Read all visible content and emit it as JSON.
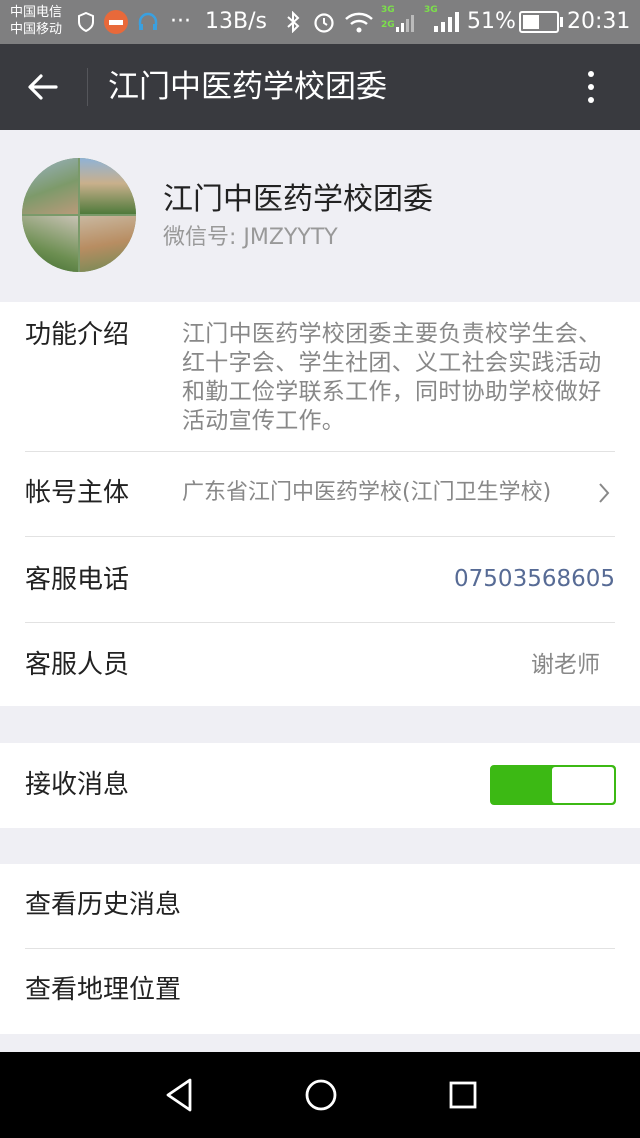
{
  "status_bar": {
    "carrier_1": "中国电信",
    "carrier_2": "中国移动",
    "more": "···",
    "speed": "13B/s",
    "net_tag_1": "3G",
    "net_tag_2": "2G",
    "net_tag_3": "3G",
    "battery_percent": "51%",
    "battery_level": 0.51,
    "time": "20:31",
    "icons": [
      "shield-icon",
      "app-icon",
      "headset-icon",
      "bluetooth-icon",
      "alarm-icon",
      "wifi-icon",
      "signal-icon",
      "battery-icon"
    ]
  },
  "header": {
    "title": "江门中医药学校团委"
  },
  "profile": {
    "name": "江门中医药学校团委",
    "wechat_id": "微信号: JMZYYTY"
  },
  "info": {
    "intro_label": "功能介绍",
    "intro_text": "江门中医药学校团委主要负责校学生会、红十字会、学生社团、义工社会实践活动和勤工俭学联系工作，同时协助学校做好活动宣传工作。",
    "entity_label": "帐号主体",
    "entity_value": "广东省江门中医药学校(江门卫生学校)",
    "phone_label": "客服电话",
    "phone_value": "07503568605",
    "staff_label": "客服人员",
    "staff_value": "谢老师"
  },
  "messages": {
    "receive_label": "接收消息",
    "receive_on": true
  },
  "actions": {
    "history_label": "查看历史消息",
    "location_label": "查看地理位置"
  },
  "colors": {
    "title_bar": "#393a3f",
    "status_bar": "#7f7f80",
    "switch_on": "#3cb914",
    "link": "#576b95"
  }
}
